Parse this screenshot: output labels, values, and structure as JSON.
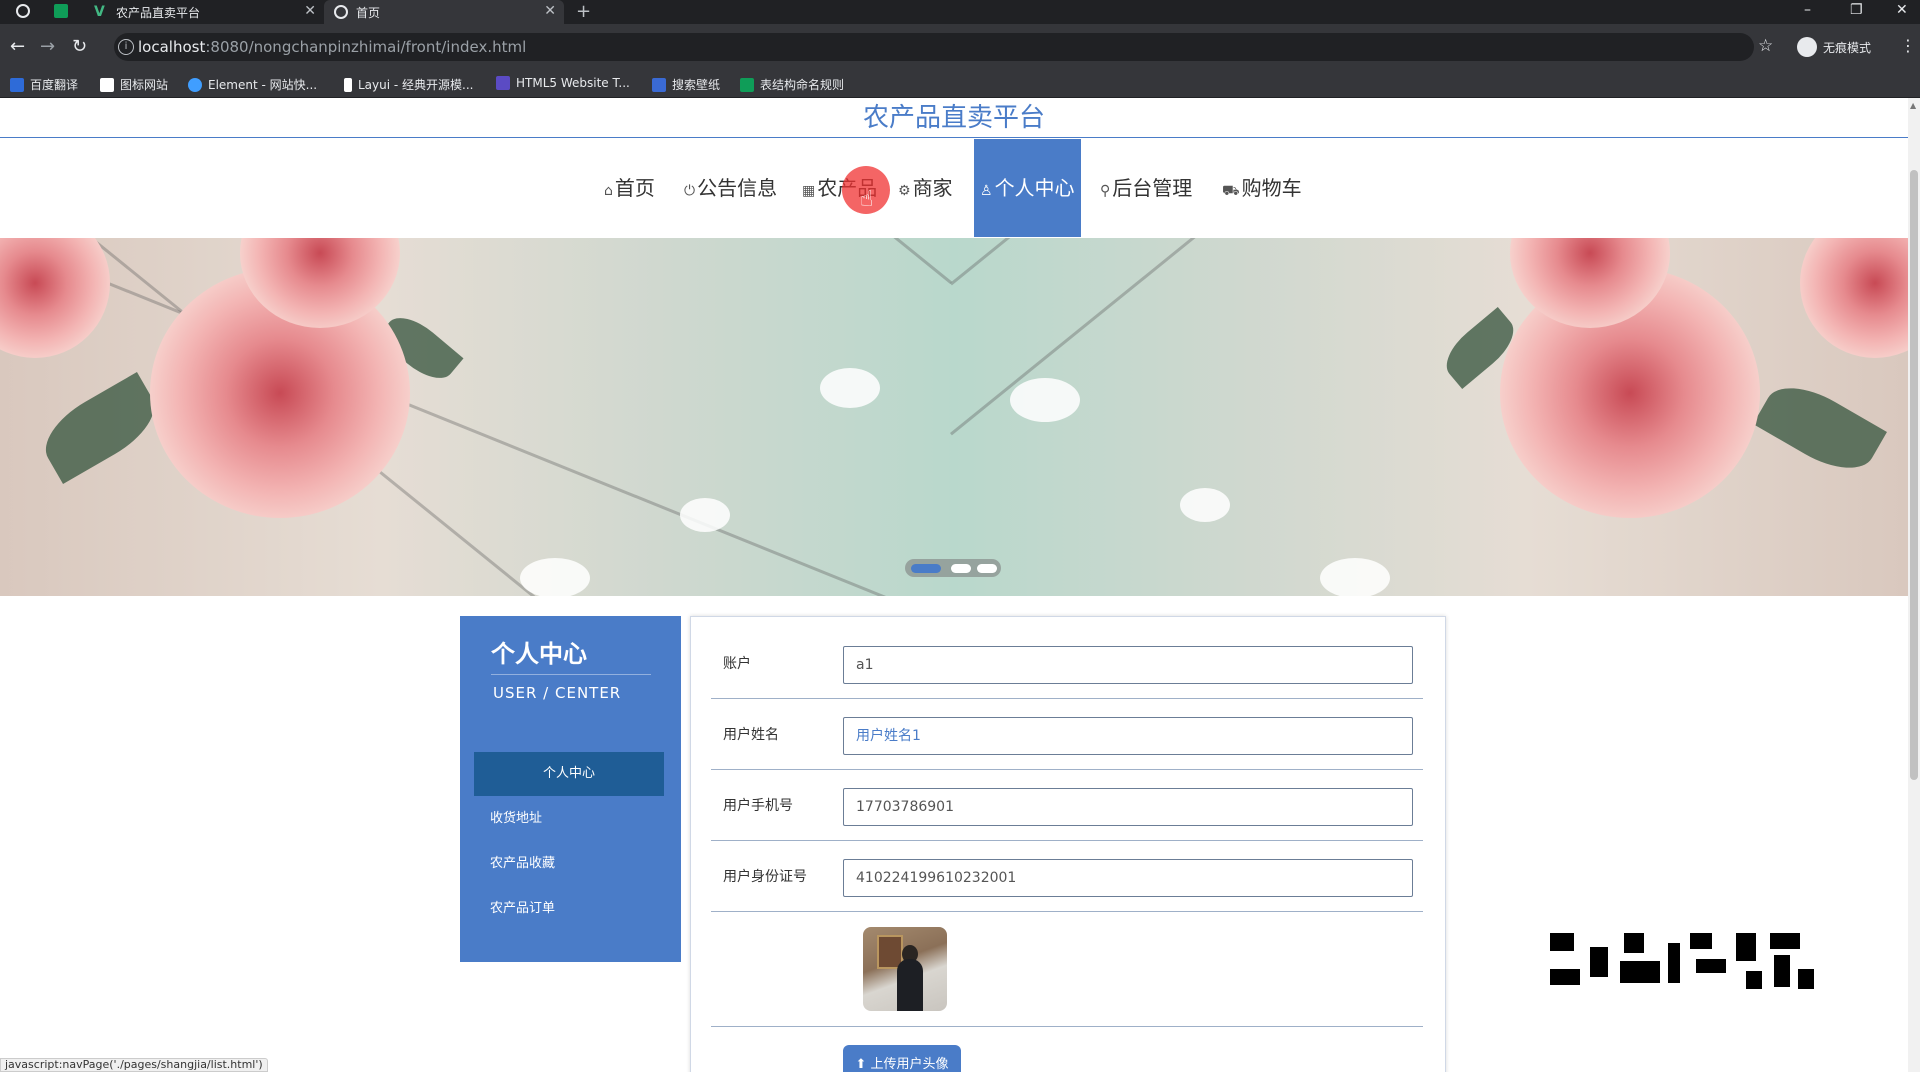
{
  "browser": {
    "tabs": [
      {
        "title": "农产品直卖平台"
      },
      {
        "title": "首页"
      }
    ],
    "url_host": "localhost",
    "url_path": ":8080/nongchanpinzhimai/front/index.html",
    "incognito_label": "无痕模式",
    "bookmarks": [
      {
        "label": "百度翻译",
        "icon_color": "#2e6bd8"
      },
      {
        "label": "图标网站",
        "icon_color": "#ffffff"
      },
      {
        "label": "Element - 网站快...",
        "icon_color": "#409eff"
      },
      {
        "label": "Layui - 经典开源模...",
        "icon_color": "#ffffff"
      },
      {
        "label": "HTML5 Website T...",
        "icon_color": "#5b4bc4"
      },
      {
        "label": "搜索壁纸",
        "icon_color": "#3a6ad4"
      },
      {
        "label": "表结构命名规则",
        "icon_color": "#0f9d58"
      }
    ],
    "status_url": "javascript:navPage('./pages/shangjia/list.html')"
  },
  "site": {
    "title": "农产品直卖平台",
    "accent_color": "#4a7cc8"
  },
  "menu": [
    {
      "label": "首页",
      "icon": "home-icon"
    },
    {
      "label": "公告信息",
      "icon": "power-icon"
    },
    {
      "label": "农产品",
      "icon": "grid-icon"
    },
    {
      "label": "商家",
      "icon": "gear-icon"
    },
    {
      "label": "个人中心",
      "icon": "user-icon",
      "active": true
    },
    {
      "label": "后台管理",
      "icon": "link-icon"
    },
    {
      "label": "购物车",
      "icon": "cart-icon"
    }
  ],
  "carousel": {
    "slides": 3,
    "active_index": 0
  },
  "sidebar": {
    "title": "个人中心",
    "subtitle": "USER / CENTER",
    "items": [
      {
        "label": "个人中心",
        "active": true
      },
      {
        "label": "收货地址"
      },
      {
        "label": "农产品收藏"
      },
      {
        "label": "农产品订单"
      }
    ]
  },
  "form": {
    "account": {
      "label": "账户",
      "value": "a1"
    },
    "name": {
      "label": "用户姓名",
      "value": "用户姓名1"
    },
    "phone": {
      "label": "用户手机号",
      "value": "17703786901"
    },
    "idcard": {
      "label": "用户身份证号",
      "value": "410224199610232001"
    },
    "upload_label": "上传用户头像"
  }
}
